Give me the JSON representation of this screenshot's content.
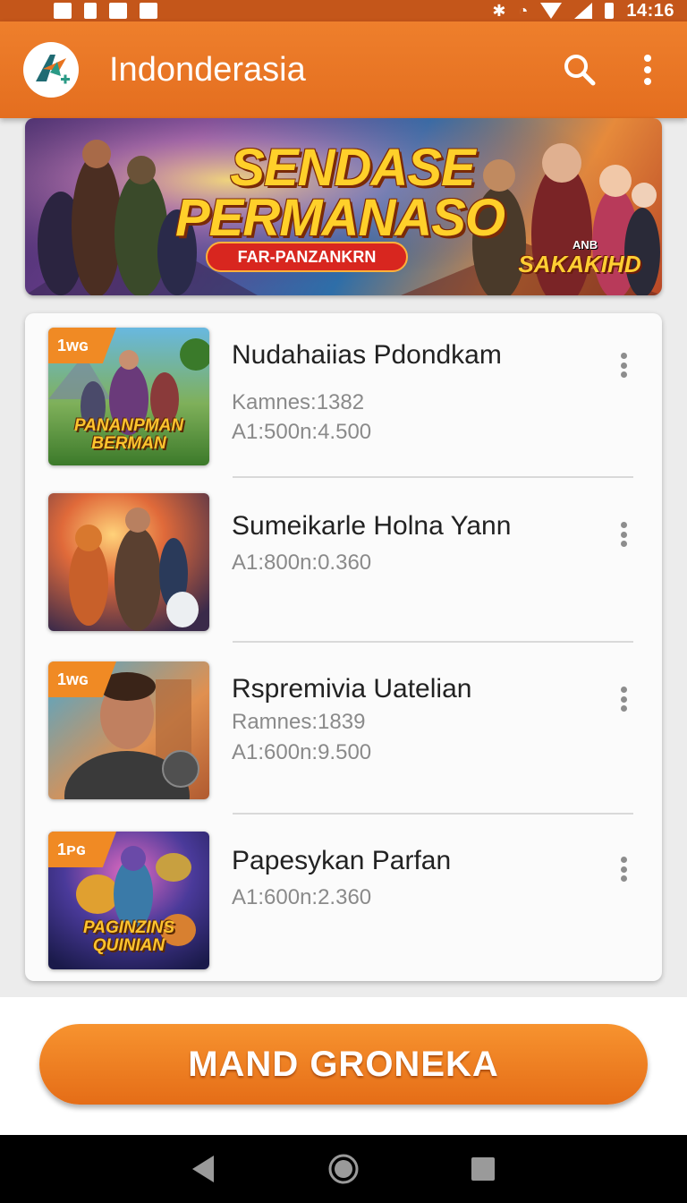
{
  "status_bar": {
    "time": "14:16",
    "icons_left": [
      "notification-icon",
      "sim-icon",
      "app-notification-icon",
      "card-notification-icon"
    ],
    "icons_right": [
      "bluetooth-icon",
      "alarm-icon",
      "wifi-icon",
      "signal-icon",
      "battery-icon"
    ]
  },
  "app_bar": {
    "title": "Indonderasia",
    "actions": [
      "search-icon",
      "more-vert-icon"
    ],
    "color": "#e8731f"
  },
  "banner": {
    "headline_line1": "SENDASE",
    "headline_line2": "PERMANASO",
    "tag": "FAR-PANZANKRN",
    "badge_small": "ANB",
    "badge": "SAKAKIHD"
  },
  "list": {
    "items": [
      {
        "title": "Nudahaiias Pdondkam",
        "meta1": "Kamnes:1382",
        "meta2": "A1:500n:4.500",
        "badge": "1ᴡɢ",
        "caption": "PANANPMAN BERMAN"
      },
      {
        "title": "Sumeikarle Holna Yann",
        "meta1": "A1:800n:0.360"
      },
      {
        "title": "Rspremivia Uatelian",
        "meta1": "Ramnes:1839",
        "meta2": "A1:600n:9.500",
        "badge": "1ᴡɢ"
      },
      {
        "title": "Papesykan Parfan",
        "meta1": "A1:600n:2.360",
        "badge": "1ᴘɢ",
        "caption": "PAGINZINS QUINIAN"
      }
    ]
  },
  "cta": {
    "label": "MAND GRONEKA"
  },
  "nav_bar": {
    "buttons": [
      "back-icon",
      "home-icon",
      "recents-icon"
    ]
  }
}
